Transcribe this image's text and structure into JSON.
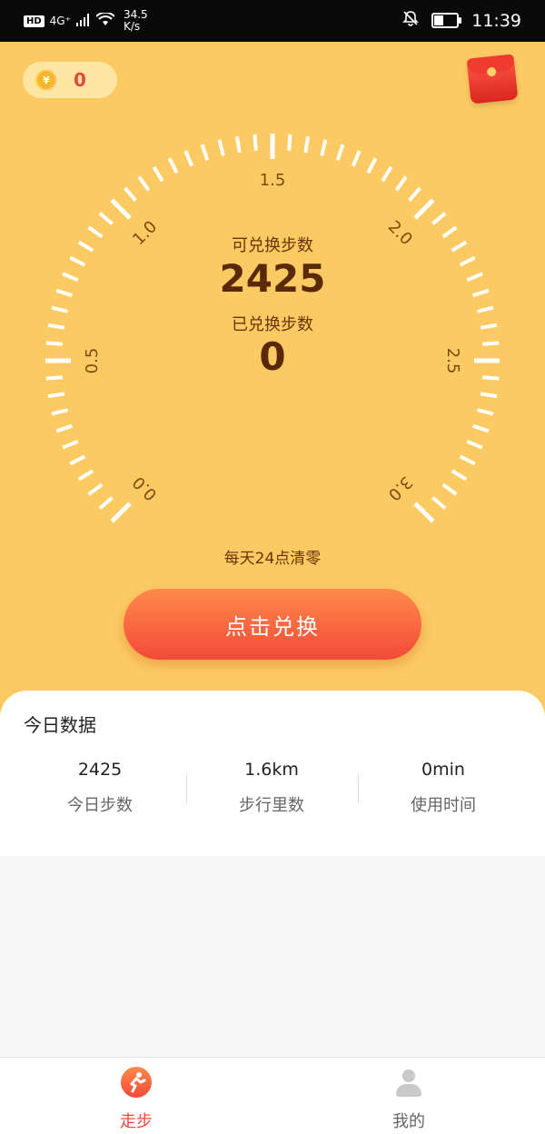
{
  "status_bar": {
    "hd": "HD",
    "network": "4G⁺",
    "speed_value": "34.5",
    "speed_unit": "K/s",
    "time": "11:39"
  },
  "header": {
    "coin_symbol": "¥",
    "coin_count": "0"
  },
  "gauge": {
    "labels": [
      "0.0",
      "0.5",
      "1.0",
      "1.5",
      "2.0",
      "2.5",
      "3.0"
    ],
    "available_label": "可兑换步数",
    "available_value": "2425",
    "redeemed_label": "已兑换步数",
    "redeemed_value": "0"
  },
  "reset_note": "每天24点清零",
  "redeem_button": "点击兑换",
  "today": {
    "title": "今日数据",
    "stats": [
      {
        "value": "2425",
        "label": "今日步数"
      },
      {
        "value": "1.6km",
        "label": "步行里数"
      },
      {
        "value": "0min",
        "label": "使用时间"
      }
    ]
  },
  "tabbar": {
    "walk": "走步",
    "me": "我的"
  },
  "colors": {
    "hero_bg": "#fcca62",
    "accent": "#f24a39",
    "text_brown": "#6b3408"
  }
}
